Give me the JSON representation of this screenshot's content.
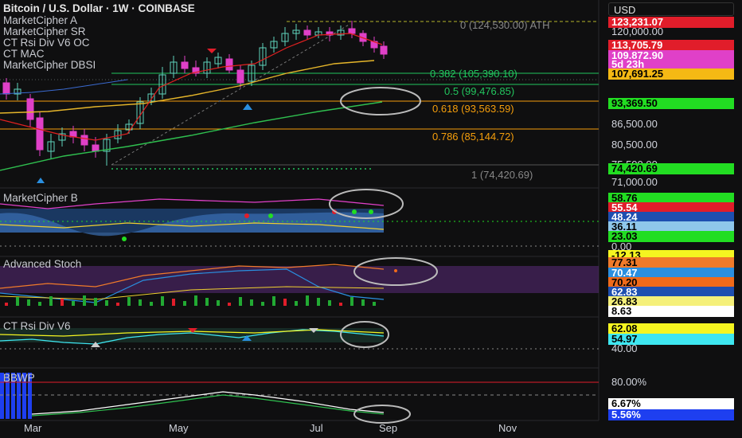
{
  "currency": "USD",
  "main_overlays": [
    "Bitcoin / U.S. Dollar · 1W · COINBASE",
    "MarketCipher A",
    "MarketCipher SR",
    "CT Rsi Div V6 OC",
    "CT MAC",
    "MarketCipher DBSI"
  ],
  "ath_label": "0 (124,530.00) ATH",
  "fib_levels": [
    {
      "label": "0.382 (105,390.10)",
      "color": "#22c55e"
    },
    {
      "label": "0.5 (99,476.85)",
      "color": "#22c55e"
    },
    {
      "label": "0.618 (93,563.59)",
      "color": "#f59e0b"
    },
    {
      "label": "0.786 (85,144.72)",
      "color": "#f59e0b"
    },
    {
      "label": "1 (74,420.69)",
      "color": "#888888"
    }
  ],
  "price_tags": [
    {
      "text": "123,231.07",
      "bg": "#e11d2a",
      "fg": "#ffffff"
    },
    {
      "text": "120,000.00",
      "bg": "",
      "fg": "#d1d4dc"
    },
    {
      "text": "113,705.79",
      "bg": "#e11d2a",
      "fg": "#ffffff"
    },
    {
      "text": "109,872.90",
      "bg": "#e040c8",
      "fg": "#ffffff"
    },
    {
      "text": "5d 23h",
      "bg": "#e040c8",
      "fg": "#ffffff"
    },
    {
      "text": "107,691.25",
      "bg": "#f5b914",
      "fg": "#000000"
    },
    {
      "text": "93,369.50",
      "bg": "#22dd22",
      "fg": "#000000"
    },
    {
      "text": "86,500.00",
      "bg": "",
      "fg": "#d1d4dc"
    },
    {
      "text": "80,500.00",
      "bg": "",
      "fg": "#d1d4dc"
    },
    {
      "text": "75,500.00",
      "bg": "",
      "fg": "#d1d4dc"
    },
    {
      "text": "74,420.69",
      "bg": "#22dd22",
      "fg": "#000000"
    },
    {
      "text": "71,000.00",
      "bg": "",
      "fg": "#d1d4dc"
    }
  ],
  "panes": [
    {
      "title": "MarketCipher B",
      "values": [
        {
          "text": "58.76",
          "bg": "#22dd22",
          "fg": "#000"
        },
        {
          "text": "55.54",
          "bg": "#e11d2a",
          "fg": "#fff"
        },
        {
          "text": "48.24",
          "bg": "#1e4fb0",
          "fg": "#fff"
        },
        {
          "text": "36.11",
          "bg": "#8fc7ea",
          "fg": "#000"
        },
        {
          "text": "23.03",
          "bg": "#22dd22",
          "fg": "#000"
        },
        {
          "text": "0.00",
          "bg": "",
          "fg": "#d1d4dc"
        },
        {
          "text": "-12.13",
          "bg": "#f5f520",
          "fg": "#000"
        }
      ]
    },
    {
      "title": "Advanced Stoch",
      "values": [
        {
          "text": "77.31",
          "bg": "#f07a2a",
          "fg": "#000"
        },
        {
          "text": "70.47",
          "bg": "#2a8fe0",
          "fg": "#fff"
        },
        {
          "text": "70.20",
          "bg": "#f06a1a",
          "fg": "#000"
        },
        {
          "text": "62.83",
          "bg": "#1e4fb0",
          "fg": "#fff"
        },
        {
          "text": "26.83",
          "bg": "#f5f07a",
          "fg": "#000"
        },
        {
          "text": "8.63",
          "bg": "#ffffff",
          "fg": "#000"
        }
      ]
    },
    {
      "title": "CT Rsi Div V6",
      "values": [
        {
          "text": "62.08",
          "bg": "#f5f520",
          "fg": "#000"
        },
        {
          "text": "54.97",
          "bg": "#3ee6f0",
          "fg": "#000"
        },
        {
          "text": "40.00",
          "bg": "",
          "fg": "#d1d4dc"
        }
      ]
    },
    {
      "title": "BBWP",
      "values": [
        {
          "text": "80.00%",
          "bg": "",
          "fg": "#d1d4dc"
        },
        {
          "text": "6.67%",
          "bg": "#ffffff",
          "fg": "#000"
        },
        {
          "text": "5.56%",
          "bg": "#1e3ff0",
          "fg": "#fff"
        }
      ]
    }
  ],
  "x_axis": [
    "Mar",
    "May",
    "Jul",
    "Sep",
    "Nov"
  ]
}
